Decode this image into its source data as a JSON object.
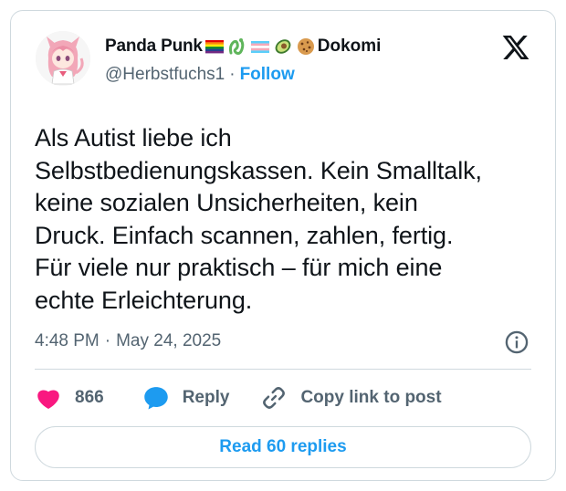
{
  "author": {
    "display_name": "Panda Punk",
    "name_suffix": "Dokomi",
    "handle": "@Herbstfuchs1",
    "separator": "·",
    "follow_label": "Follow",
    "emojis": [
      "rainbow-flag-icon",
      "dragon-icon",
      "transgender-flag-icon",
      "avocado-icon",
      "cookie-icon"
    ]
  },
  "tweet": {
    "lines": [
      "Als Autist liebe ich",
      "Selbstbedienungskassen. Kein Smalltalk,",
      "keine sozialen Unsicherheiten, kein",
      "Druck. Einfach scannen, zahlen, fertig.",
      "Für viele nur praktisch – für mich eine",
      "echte Erleichterung."
    ]
  },
  "meta": {
    "time": "4:48 PM",
    "separator": "·",
    "date": "May 24, 2025"
  },
  "actions": {
    "like_count": "866",
    "reply_label": "Reply",
    "copy_link_label": "Copy link to post"
  },
  "read_replies_label": "Read 60 replies",
  "colors": {
    "accent": "#1d9bf0",
    "like": "#f91880",
    "border": "#cfd9de",
    "secondary_text": "#536471"
  }
}
